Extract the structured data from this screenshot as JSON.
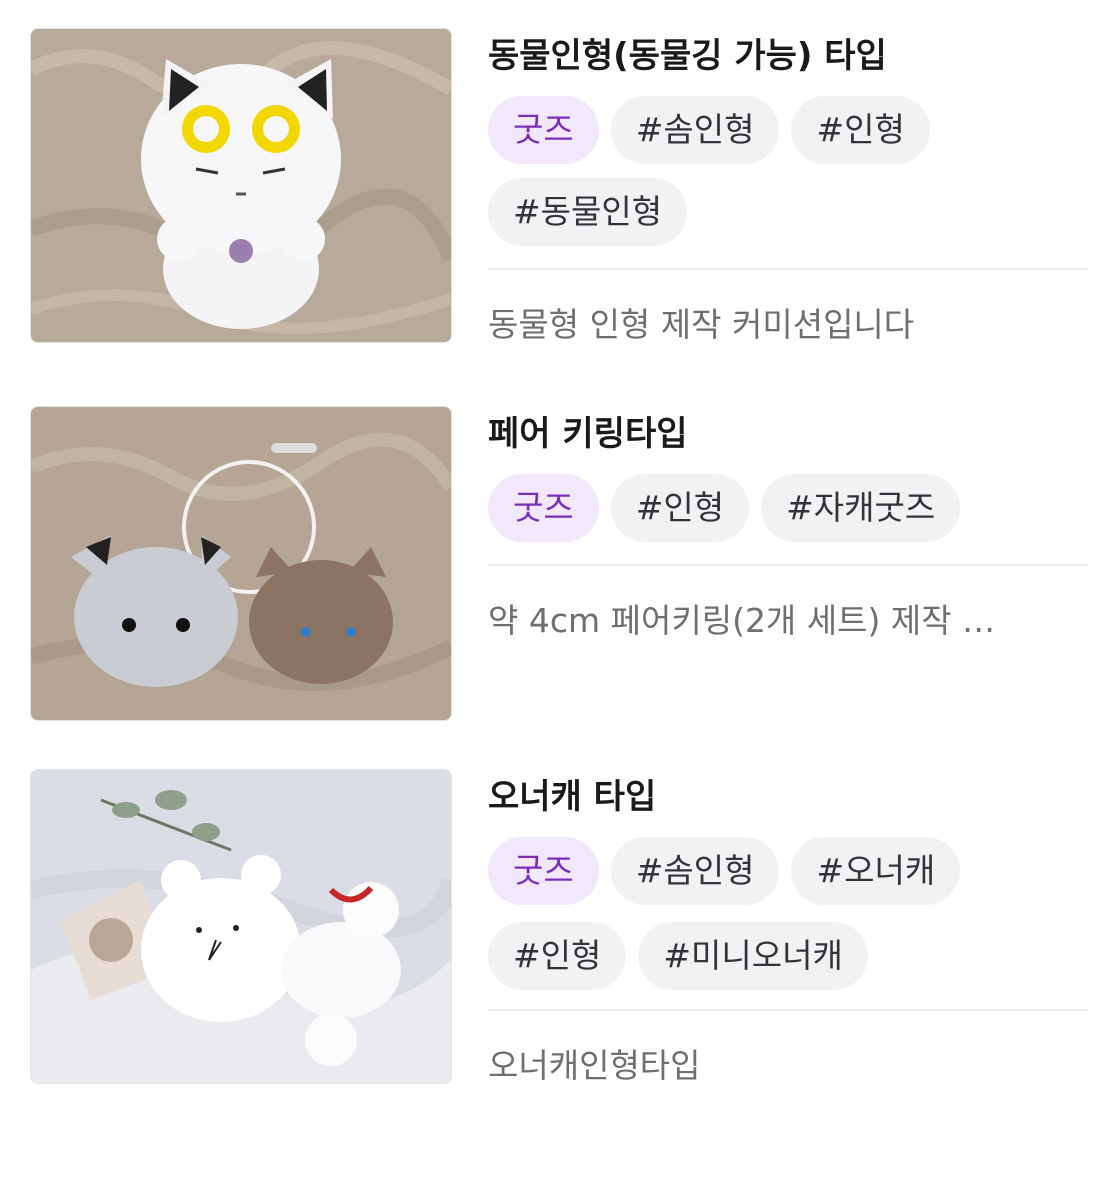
{
  "colors": {
    "category_tag_bg": "#f1e8fb",
    "category_tag_text": "#7a2fb8",
    "hashtag_bg": "#f2f2f4",
    "description_text": "#6e6e73"
  },
  "items": [
    {
      "title": "동물인형(동물깅 가능) 타입",
      "image_alt": "white fluffy cat plush with yellow goggles",
      "tags": [
        "굿즈",
        "#솜인형",
        "#인형",
        "#동물인형"
      ],
      "description": "동물형 인형 제작 커미션입니다"
    },
    {
      "title": "페어 키링타입",
      "image_alt": "two round plush keyrings on a ring",
      "tags": [
        "굿즈",
        "#인형",
        "#자캐굿즈"
      ],
      "description": "약 4cm 페어키링(2개 세트) 제작 …"
    },
    {
      "title": "오너캐 타입",
      "image_alt": "white bird plush lying next to a bouquet",
      "tags": [
        "굿즈",
        "#솜인형",
        "#오너캐",
        "#인형",
        "#미니오너캐"
      ],
      "description": "오너캐인형타입"
    }
  ]
}
